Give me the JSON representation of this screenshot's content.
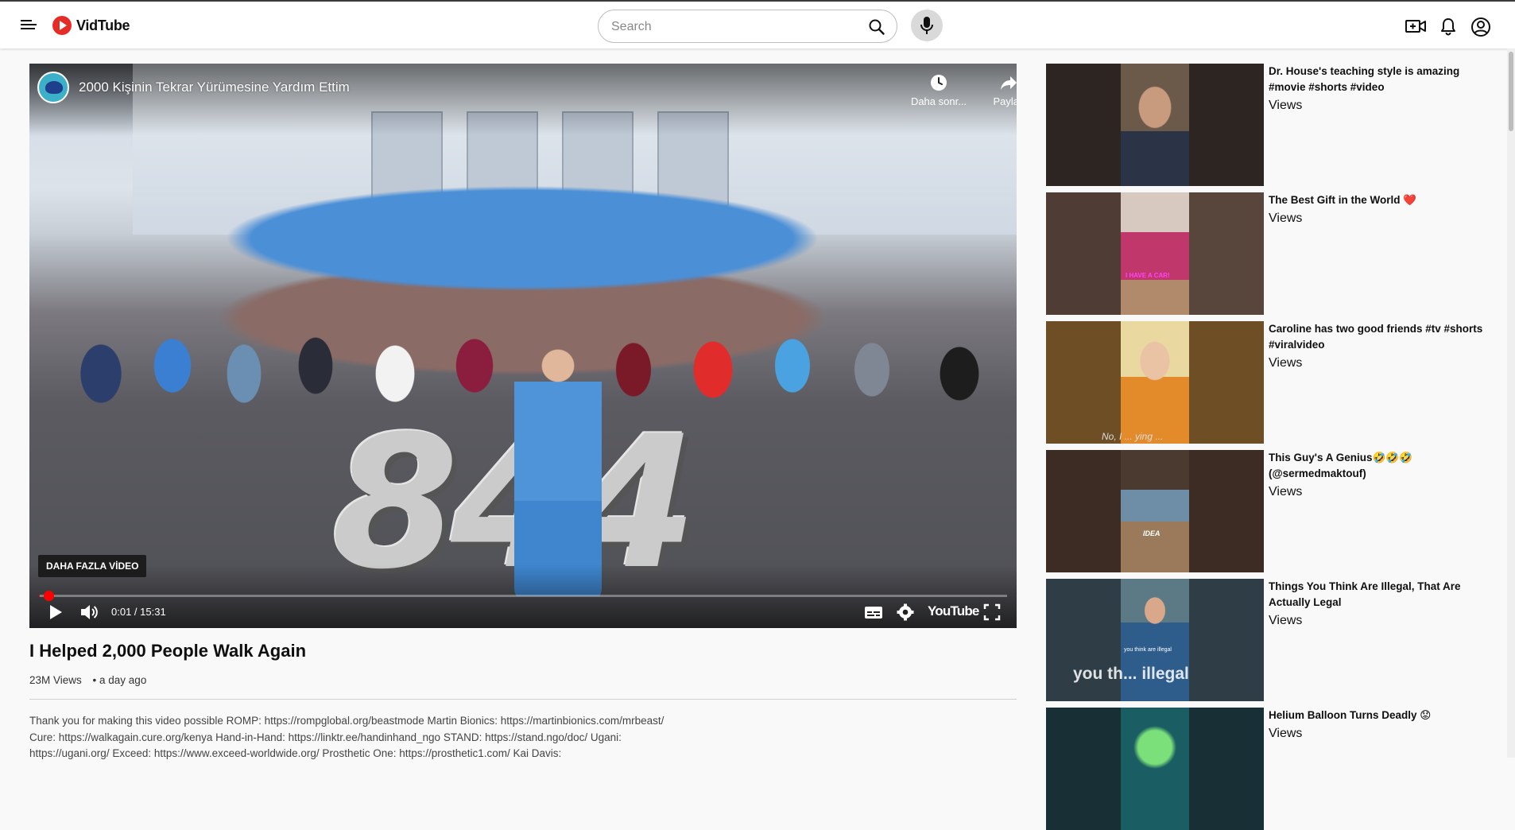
{
  "app": {
    "name": "VidTube"
  },
  "search": {
    "placeholder": "Search"
  },
  "icons": {
    "menu": "hamburger-menu-icon",
    "search": "search-icon",
    "mic": "microphone-icon",
    "create": "video-camera-icon",
    "notifications": "bell-icon",
    "account": "account-icon"
  },
  "colors": {
    "brand": "#e52d27",
    "progress": "#ff0000"
  },
  "player": {
    "overlay_title": "2000 Kişinin Tekrar Yürümesine Yardım Ettim",
    "watch_later_label": "Daha sonr...",
    "share_label": "Paylaş",
    "more_videos_label": "DAHA FAZLA VİDEO",
    "big_number": "844",
    "time_display": "0:01 / 15:31",
    "progress_fraction": 0.001,
    "youtube_label": "YouTube"
  },
  "video": {
    "title": "I Helped 2,000 People Walk Again",
    "views": "23M Views",
    "age": "• a day ago",
    "description_lines": [
      "Thank you for making this video possible ROMP: https://rompglobal.org/beastmode Martin Bionics: https://martinbionics.com/mrbeast/",
      "Cure: https://walkagain.cure.org/kenya Hand-in-Hand: https://linktr.ee/handinhand_ngo STAND: https://stand.ngo/doc/ Ugani:",
      "https://ugani.org/ Exceed: https://www.exceed-worldwide.org/ Prosthetic One: https://prosthetic1.com/ Kai Davis:"
    ]
  },
  "recommendations": [
    {
      "title": "Dr. House's teaching style is amazing #movie #shorts #video",
      "views": "Views"
    },
    {
      "title": "The Best Gift in the World",
      "emoji": "❤️",
      "views": "Views"
    },
    {
      "title": "Caroline has two good friends #tv #shorts #viralvideo",
      "views": "Views"
    },
    {
      "title": "This Guy's A Genius",
      "emoji": "🤣🤣🤣",
      "title_line2": "(@sermedmaktouf)",
      "views": "Views"
    },
    {
      "title": "Things You Think Are Illegal, That Are Actually Legal",
      "views": "Views"
    },
    {
      "title": "Helium Balloon Turns Deadly",
      "emoji": "😟",
      "views": "Views"
    }
  ],
  "thumb_captions": {
    "rec2": "I HAVE A CAR!",
    "rec3": "No, I ... ying ...",
    "rec4": "IDEA",
    "rec5_small": "you think are illegal",
    "rec5_big": "you th... illegal"
  }
}
